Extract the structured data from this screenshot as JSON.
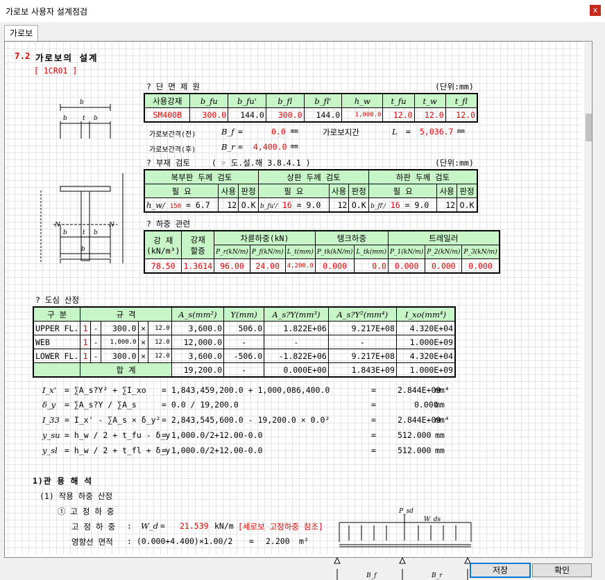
{
  "window": {
    "title": "가로보 사용자 설계점검",
    "close": "x"
  },
  "tab": "가로보",
  "section": {
    "num": "7.2",
    "title": "가로보의 설계",
    "code": "[ 1CR01 ]"
  },
  "sectionProps": {
    "title": "? 단 면 제 원",
    "unit": "(단위:mm)",
    "headers": [
      "사용강재",
      "b_fu",
      "b_fu'",
      "b_fl",
      "b_fl'",
      "h_w",
      "t_fu",
      "t_w",
      "t_fl"
    ],
    "row": [
      "SM400B",
      "300.0",
      "144.0",
      "300.0",
      "144.0",
      "1,000.0",
      "12.0",
      "12.0",
      "12.0"
    ],
    "spacingFront": {
      "label": "가로보간격(전)",
      "sym": "B_f",
      "eq": "=",
      "val": "0.0",
      "unit": "mm"
    },
    "spacingBack": {
      "label": "가로보간격(후)",
      "sym": "B_r",
      "eq": "=",
      "val": "4,400.0",
      "unit": "mm"
    },
    "span": {
      "label": "가로보지간",
      "sym": "L",
      "eq": "=",
      "val": "5,036.7",
      "unit": "mm"
    }
  },
  "member": {
    "title": "? 부재 검토",
    "ref": "( ☞ 도.설.해 3.8.4.1 )",
    "unit": "(단위:mm)",
    "groups": [
      "복부판 두께 검토",
      "상판 두께 검토",
      "하판 두께 검토"
    ],
    "sub": [
      "필 요",
      "사용",
      "판정",
      "필 요",
      "사용",
      "판정",
      "필 요",
      "사용",
      "판정"
    ],
    "row": {
      "w1": "h_w/",
      "w2": "150",
      "w3": "6.7",
      "w4": "12",
      "w5": "O.K",
      "u1": "b_fu'/",
      "u2": "16",
      "u3": "9.0",
      "u4": "12",
      "u5": "O.K",
      "l1": "b_fl'/",
      "l2": "16",
      "l3": "9.0",
      "l4": "12",
      "l5": "O.K"
    }
  },
  "load": {
    "title": "? 하중 관련",
    "h1": [
      "강 재",
      "강재"
    ],
    "h1b": [
      "(kN/m³)",
      "할증"
    ],
    "groups": [
      "차륜하중(kN)",
      "탱크하중",
      "트레일러"
    ],
    "sub": [
      "P_r(kN/m)",
      "P_f(kN/m)",
      "L_t(mm)",
      "P_tk(kN/m)",
      "L_tk(mm)",
      "P_1(kN/m)",
      "P_2(kN/m)",
      "P_3(kN/m)"
    ],
    "row": [
      "78.50",
      "1.3614",
      "96.00",
      "24.00",
      "4,200.0",
      "0.000",
      "0.0",
      "0.000",
      "0.000",
      "0.000"
    ]
  },
  "centroid": {
    "title": "? 도심 산정",
    "headers": [
      "구 분",
      "규 격",
      "A_s(mm²)",
      "Y(mm)",
      "A_s?Y(mm³)",
      "A_s?Y²(mm⁴)",
      "I_xo(mm⁴)"
    ],
    "rows": [
      {
        "name": "UPPER FL.",
        "n": "1",
        "d": "-",
        "w": "300.0",
        "x": "×",
        "t": "12.0",
        "a": "3,600.0",
        "y": "506.0",
        "ay": "1.822E+06",
        "ay2": "9.217E+08",
        "i": "4.320E+04"
      },
      {
        "name": "WEB",
        "n": "1",
        "d": "-",
        "w": "1,000.0",
        "x": "×",
        "t": "12.0",
        "a": "12,000.0",
        "y": "-",
        "ay": "-",
        "ay2": "-",
        "i": "1.000E+09"
      },
      {
        "name": "LOWER FL.",
        "n": "1",
        "d": "-",
        "w": "300.0",
        "x": "×",
        "t": "12.0",
        "a": "3,600.0",
        "y": "-506.0",
        "ay": "-1.822E+06",
        "ay2": "9.217E+08",
        "i": "4.320E+04"
      }
    ],
    "total": {
      "label": "합 계",
      "a": "19,200.0",
      "y": "-",
      "ay": "0.000E+00",
      "ay2": "1.843E+09",
      "i": "1.000E+09"
    }
  },
  "formulas": [
    {
      "lhs": "I_x'",
      "eq": "= ∑A_s?Y² + ∑I_xo",
      "rhs": "= 1,843,459,200.0 + 1,000,086,400.0",
      "res": "2.844E+09",
      "unit": "mm⁴"
    },
    {
      "lhs": "δ_y",
      "eq": "= ∑A_s?Y / ∑A_s",
      "rhs": "= 0.0 / 19,200.0",
      "res": "0.000",
      "unit": "mm"
    },
    {
      "lhs": "I_33",
      "eq": "= I_x' - ∑A_s × δ_y²",
      "rhs": "= 2,843,545,600.0 - 19,200.0 × 0.0²",
      "res": "2.844E+09",
      "unit": "mm⁴"
    },
    {
      "lhs": "y_su",
      "eq": "= h_w / 2 + t_fu - δ_y",
      "rhs": "= 1,000.0/2+12.00-0.0",
      "res": "512.000",
      "unit": "mm"
    },
    {
      "lhs": "y_sl",
      "eq": "= h_w / 2 + t_fl + δ_y",
      "rhs": "= 1,000.0/2+12.00-0.0",
      "res": "512.000",
      "unit": "mm"
    }
  ],
  "analysis": {
    "title": "1)관 용 해 석",
    "sub1": "(1) 작용 하중 산정",
    "sub2": "① 고 정 하 중",
    "dl": {
      "label": "고 정 하 중",
      "colon": ":",
      "sym": "W_d",
      "eq": "=",
      "val": "21.539",
      "unit": "kN/m",
      "note": "[세로보 고정하중 참조]"
    },
    "area": {
      "label": "영향선 면적",
      "expr": ": (0.000+4.400)×1.00/2",
      "eq": "=",
      "val": "2.200",
      "unit": "m²"
    },
    "diagram": {
      "p": "P_sd",
      "w": "W_ds",
      "bf": "B_f",
      "br": "B_r"
    }
  },
  "buttons": {
    "save": "저장",
    "ok": "확인"
  }
}
